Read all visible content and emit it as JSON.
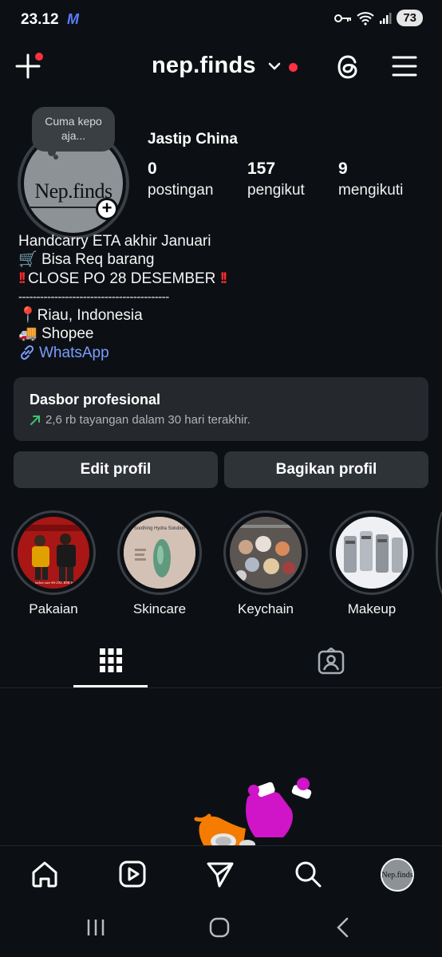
{
  "status_bar": {
    "time": "23.12",
    "app_badge": "M",
    "battery": "73"
  },
  "header": {
    "username": "nep.finds"
  },
  "profile": {
    "avatar_text": "Nep.finds",
    "note": "Cuma kepo aja...",
    "display_name": "Jastip China",
    "stats": [
      {
        "value": "0",
        "label": "postingan"
      },
      {
        "value": "157",
        "label": "pengikut"
      },
      {
        "value": "9",
        "label": "mengikuti"
      }
    ]
  },
  "bio": {
    "line1": "Handcarry ETA akhir Januari",
    "line2": "Bisa Req barang",
    "line3": "CLOSE PO 28 DESEMBER",
    "divider": "------------------------------------------",
    "location": "Riau, Indonesia",
    "shop": "Shopee",
    "link": "WhatsApp"
  },
  "dashboard": {
    "title": "Dasbor profesional",
    "subtitle": "2,6 rb tayangan dalam 30 hari terakhir."
  },
  "buttons": {
    "edit": "Edit profil",
    "share": "Bagikan profil"
  },
  "highlights": [
    {
      "label": "Pakaian",
      "caption": "Adidas jacket size SS-2XL IDR for price"
    },
    {
      "label": "Skincare",
      "caption": "Soothing Hydra Solution"
    },
    {
      "label": "Keychain"
    },
    {
      "label": "Makeup"
    }
  ],
  "bottom_nav": {
    "avatar_text": "Nep.finds"
  },
  "colors": {
    "background": "#0c1014",
    "card": "#25292e",
    "button": "#2e3338",
    "notification": "#ff3040",
    "link": "#7b9cff",
    "trend": "#3cc46b"
  }
}
